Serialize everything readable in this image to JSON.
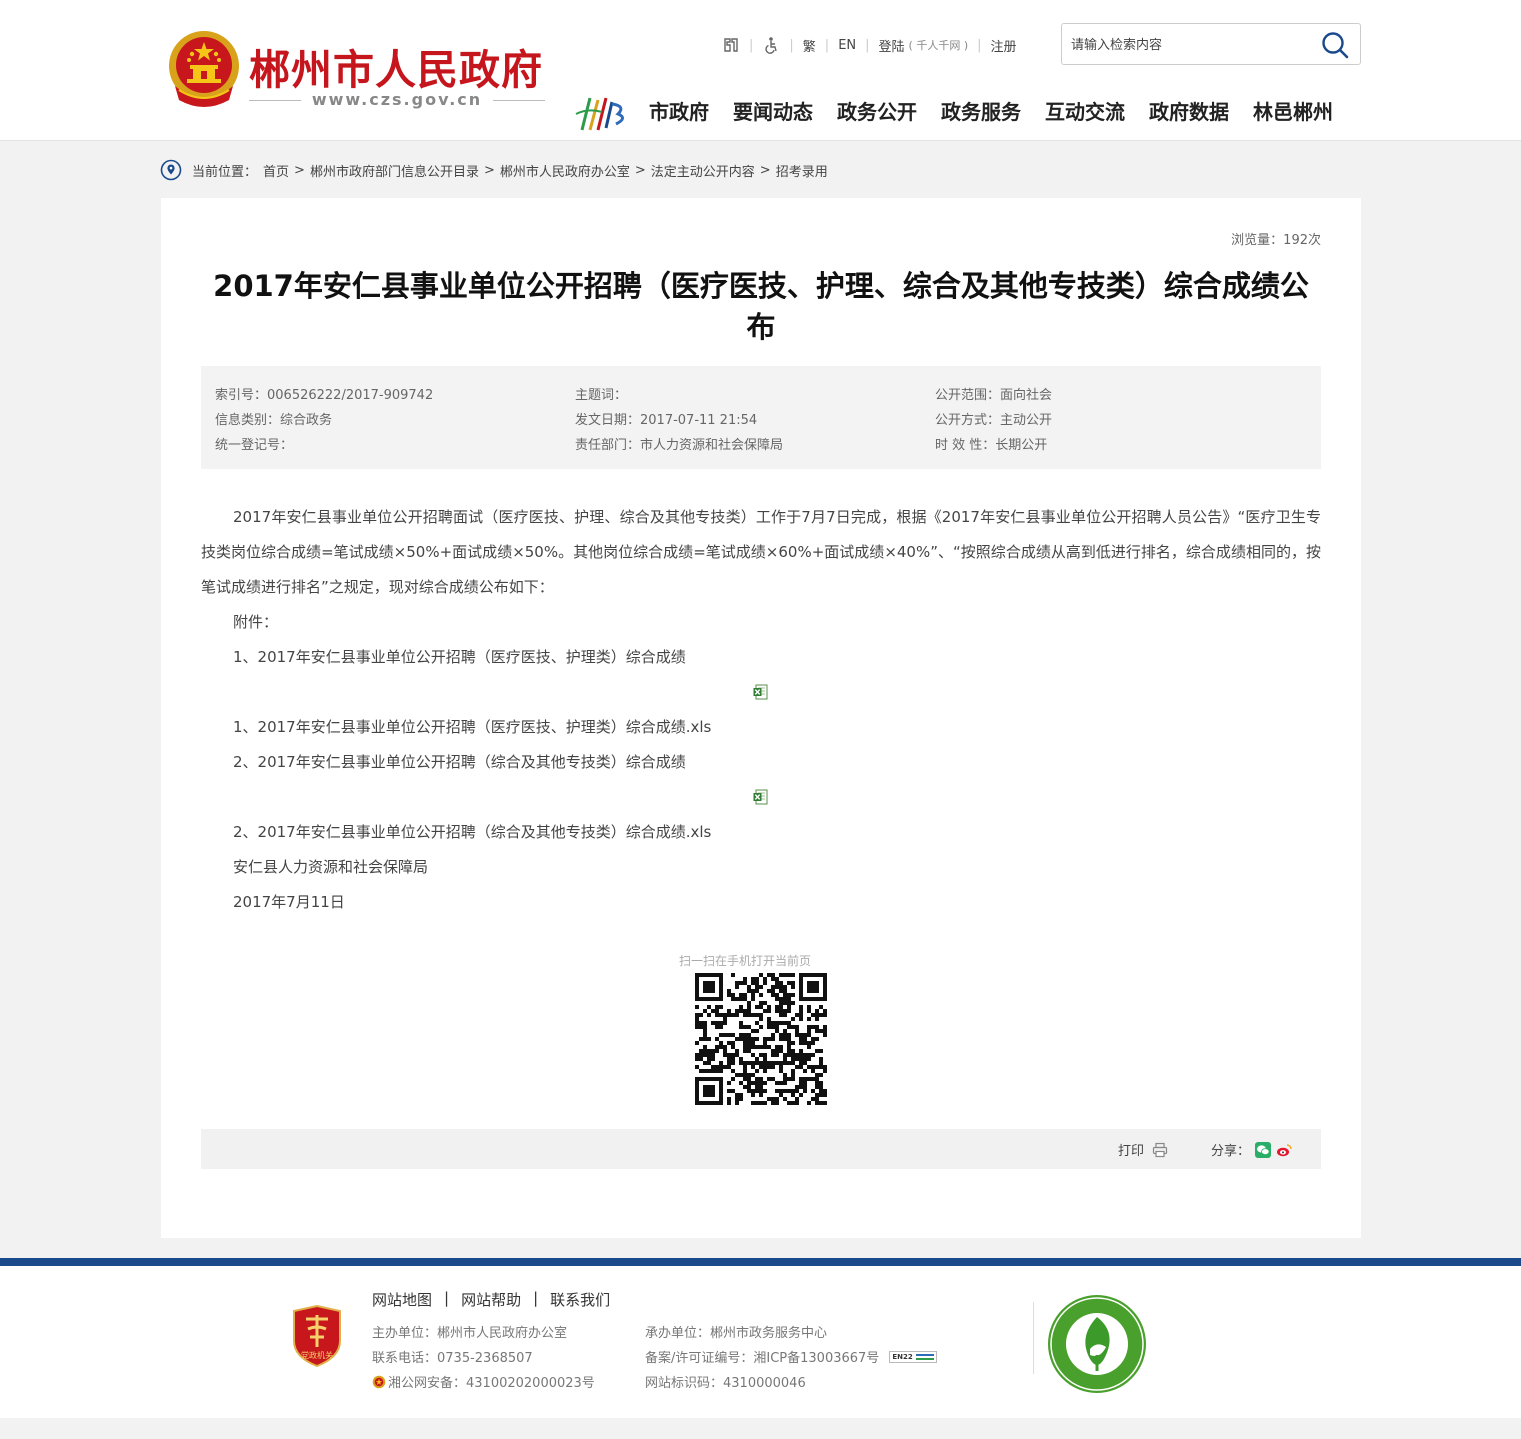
{
  "header": {
    "site_name": "郴州市人民政府",
    "site_url": "www.czs.gov.cn",
    "toplinks": {
      "traditional": "繁",
      "english": "EN",
      "login": "登陆",
      "login_note": "( 千人千网 )",
      "register": "注册"
    },
    "search": {
      "placeholder": "请输入检索内容"
    },
    "nav": [
      "市政府",
      "要闻动态",
      "政务公开",
      "政务服务",
      "互动交流",
      "政府数据",
      "林邑郴州"
    ]
  },
  "breadcrumb": {
    "label": "当前位置：",
    "items": [
      "首页",
      "郴州市政府部门信息公开目录",
      "郴州市人民政府办公室",
      "法定主动公开内容",
      "招考录用"
    ]
  },
  "article": {
    "views": "浏览量：192次",
    "title": "2017年安仁县事业单位公开招聘（医疗医技、护理、综合及其他专技类）综合成绩公布",
    "meta": {
      "index_no": "索引号：006526222/2017-909742",
      "keywords": "主题词：",
      "scope": "公开范围：面向社会",
      "category": "信息类别：综合政务",
      "publish_date": "发文日期：2017-07-11 21:54",
      "method": "公开方式：主动公开",
      "reg_no": "统一登记号：",
      "department": "责任部门：市人力资源和社会保障局",
      "validity": "时 效 性：长期公开"
    },
    "body_para": "2017年安仁县事业单位公开招聘面试（医疗医技、护理、综合及其他专技类）工作于7月7日完成，根据《2017年安仁县事业单位公开招聘人员公告》“医疗卫生专技类岗位综合成绩=笔试成绩×50%+面试成绩×50%。其他岗位综合成绩=笔试成绩×60%+面试成绩×40%”、“按照综合成绩从高到低进行排名，综合成绩相同的，按笔试成绩进行排名”之规定，现对综合成绩公布如下：",
    "attachments_label": "附件：",
    "attachment1_title": "1、2017年安仁县事业单位公开招聘（医疗医技、护理类）综合成绩",
    "attachment1_file": "1、2017年安仁县事业单位公开招聘（医疗医技、护理类）综合成绩.xls",
    "attachment2_title": "2、2017年安仁县事业单位公开招聘（综合及其他专技类）综合成绩",
    "attachment2_file": "2、2017年安仁县事业单位公开招聘（综合及其他专技类）综合成绩.xls",
    "signature": "安仁县人力资源和社会保障局",
    "sign_date": "2017年7月11日",
    "qr_caption": "扫一扫在手机打开当前页",
    "print_label": "打印",
    "share_label": "分享："
  },
  "footer": {
    "links": [
      "网站地图",
      "网站帮助",
      "联系我们"
    ],
    "host": "主办单位：郴州市人民政府办公室",
    "undertaker": "承办单位：郴州市政务服务中心",
    "phone": "联系电话：0735-2368507",
    "icp": "备案/许可证编号：湘ICP备13003667号",
    "en22": "EN22",
    "police": "湘公网安备：43100202000023号",
    "site_code": "网站标识码：4310000046",
    "party_badge_text": "党政机关"
  },
  "colors": {
    "brand_red": "#c5161d",
    "footer_blue": "#1b4a8c"
  }
}
